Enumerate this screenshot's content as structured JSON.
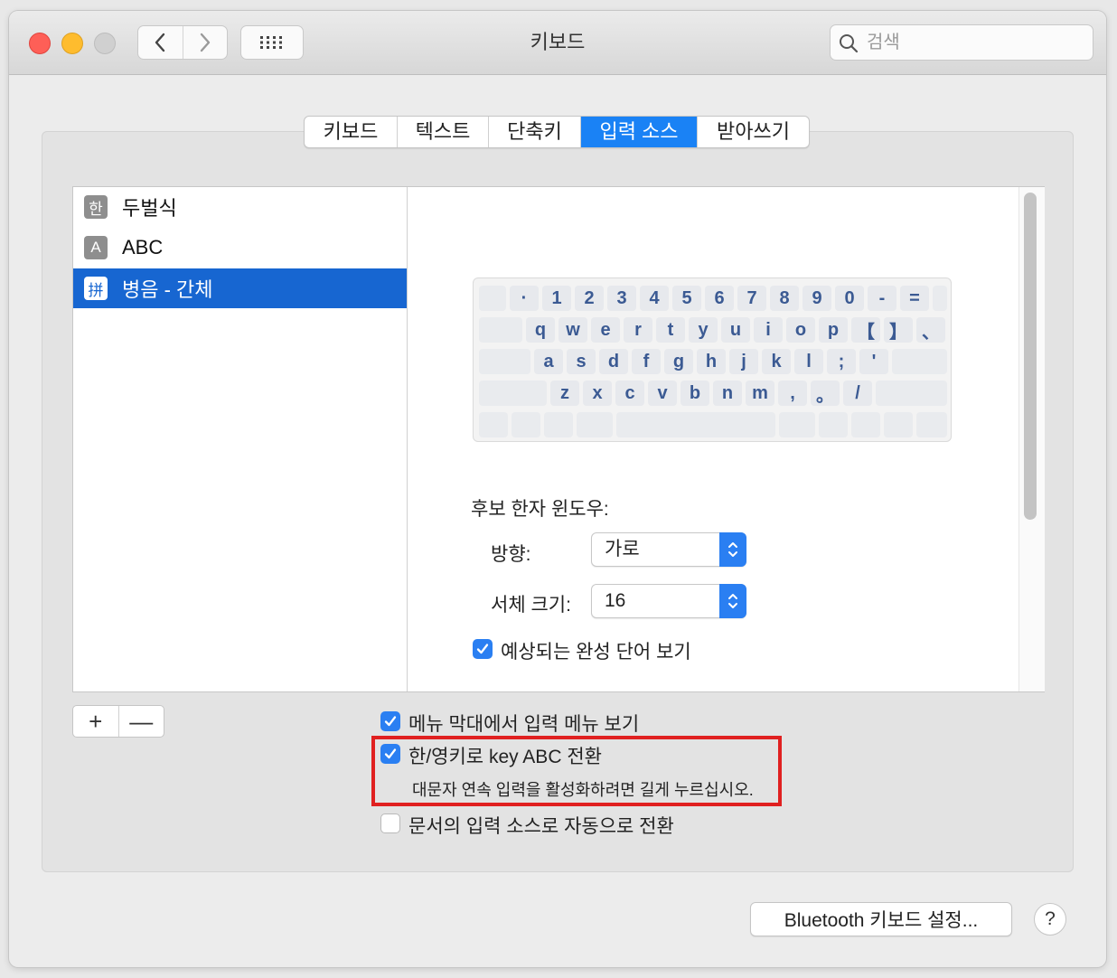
{
  "window": {
    "title": "키보드"
  },
  "search": {
    "placeholder": "검색"
  },
  "tabs": [
    {
      "label": "키보드",
      "selected": false
    },
    {
      "label": "텍스트",
      "selected": false
    },
    {
      "label": "단축키",
      "selected": false
    },
    {
      "label": "입력 소스",
      "selected": true
    },
    {
      "label": "받아쓰기",
      "selected": false
    }
  ],
  "input_sources": [
    {
      "icon_char": "한",
      "label": "두벌식",
      "selected": false
    },
    {
      "icon_char": "A",
      "label": "ABC",
      "selected": false
    },
    {
      "icon_char": "拼",
      "label": "병음 - 간체",
      "selected": true
    }
  ],
  "keyboard_rows": [
    [
      "·",
      "1",
      "2",
      "3",
      "4",
      "5",
      "6",
      "7",
      "8",
      "9",
      "0",
      "-",
      "="
    ],
    [
      "q",
      "w",
      "e",
      "r",
      "t",
      "y",
      "u",
      "i",
      "o",
      "p",
      "【",
      "】",
      "、"
    ],
    [
      "a",
      "s",
      "d",
      "f",
      "g",
      "h",
      "j",
      "k",
      "l",
      ";",
      "'"
    ],
    [
      "z",
      "x",
      "c",
      "v",
      "b",
      "n",
      "m",
      ",",
      "。",
      "/"
    ]
  ],
  "candidate": {
    "heading": "후보 한자 윈도우:",
    "orientation_label": "방향:",
    "orientation_value": "가로",
    "font_size_label": "서체 크기:",
    "font_size_value": "16",
    "predictive_label": "예상되는 완성 단어 보기",
    "predictive_checked": true
  },
  "list_buttons": {
    "add": "+",
    "remove": "—"
  },
  "options": {
    "show_menu_label": "메뉴 막대에서 입력 메뉴 보기",
    "show_menu_checked": true,
    "hanyoung_label": "한/영키로 key ABC 전환",
    "hanyoung_checked": true,
    "hanyoung_note": "대문자 연속 입력을 활성화하려면 길게 누르십시오.",
    "auto_switch_label": "문서의 입력 소스로 자동으로 전환",
    "auto_switch_checked": false
  },
  "footer": {
    "bluetooth_button": "Bluetooth 키보드 설정...",
    "help_button": "?"
  },
  "colors": {
    "accent": "#2a7ff2",
    "selection": "#1766d1",
    "highlight_box": "#e02020",
    "key_text": "#3b5a93"
  }
}
